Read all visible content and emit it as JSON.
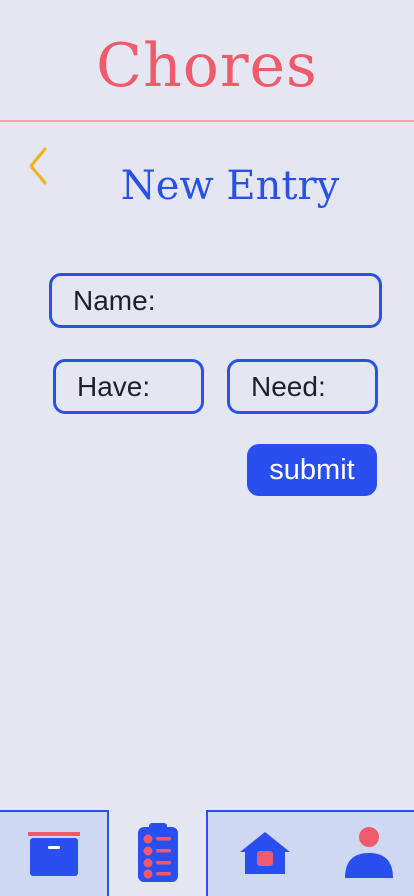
{
  "app": {
    "title": "Chores"
  },
  "page": {
    "title": "New Entry"
  },
  "form": {
    "name_label": "Name:",
    "have_label": "Have:",
    "need_label": "Need:",
    "submit_label": "submit"
  },
  "icons": {
    "back": "chevron-left-icon",
    "archive": "archive-box-icon",
    "chores": "clipboard-list-icon",
    "home": "home-icon",
    "profile": "user-icon"
  },
  "colors": {
    "background": "#e4e7f2",
    "accent": "#2a51e6",
    "brand": "#f05a6a",
    "back_arrow": "#f2b21d",
    "nav_background": "#cfd8f3"
  }
}
